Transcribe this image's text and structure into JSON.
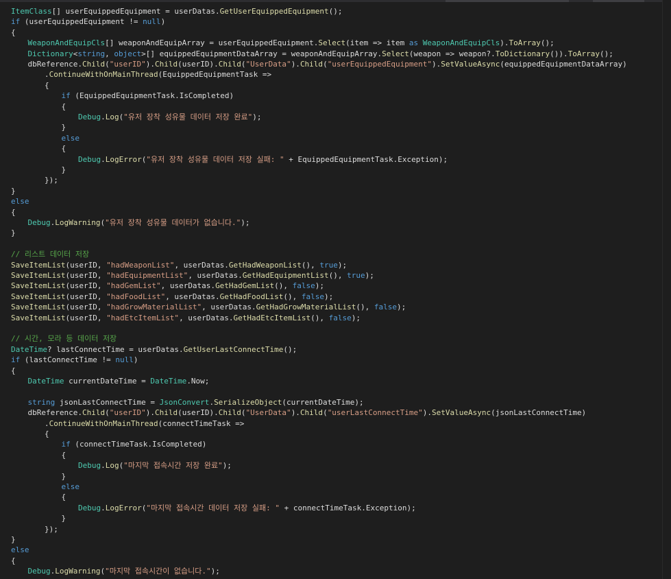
{
  "theme": {
    "background": "#1e1e1e",
    "type_color": "#4ec9b0",
    "keyword_color": "#569cd6",
    "string_color": "#d69d85",
    "comment_color": "#57a64a",
    "method_color": "#dcdcaa",
    "plain_color": "#dcdcdc"
  },
  "code": [
    {
      "indent": 0,
      "tokens": [
        [
          "ItemClass",
          "type"
        ],
        [
          "[] userEquippedEquipment = userDatas.",
          "p"
        ],
        [
          "GetUserEquippedEquipment",
          "m"
        ],
        [
          "();",
          "p"
        ]
      ]
    },
    {
      "indent": 0,
      "tokens": [
        [
          "if",
          "kw"
        ],
        [
          " (userEquippedEquipment != ",
          "p"
        ],
        [
          "null",
          "kw"
        ],
        [
          ")",
          "p"
        ]
      ]
    },
    {
      "indent": 0,
      "tokens": [
        [
          "{",
          "p"
        ]
      ]
    },
    {
      "indent": 1,
      "tokens": [
        [
          "WeaponAndEquipCls",
          "type"
        ],
        [
          "[] weaponAndEquipArray = userEquippedEquipment.",
          "p"
        ],
        [
          "Select",
          "m"
        ],
        [
          "(item => item ",
          "p"
        ],
        [
          "as",
          "kw"
        ],
        [
          " ",
          "p"
        ],
        [
          "WeaponAndEquipCls",
          "type"
        ],
        [
          ").",
          "p"
        ],
        [
          "ToArray",
          "m"
        ],
        [
          "();",
          "p"
        ]
      ]
    },
    {
      "indent": 1,
      "tokens": [
        [
          "Dictionary",
          "type"
        ],
        [
          "<",
          "p"
        ],
        [
          "string",
          "kw"
        ],
        [
          ", ",
          "p"
        ],
        [
          "object",
          "kw"
        ],
        [
          ">[] equippedEquipmentDataArray = weaponAndEquipArray.",
          "p"
        ],
        [
          "Select",
          "m"
        ],
        [
          "(weapon => weapon?.",
          "p"
        ],
        [
          "ToDictionary",
          "m"
        ],
        [
          "()).",
          "p"
        ],
        [
          "ToArray",
          "m"
        ],
        [
          "();",
          "p"
        ]
      ]
    },
    {
      "indent": 1,
      "tokens": [
        [
          "dbReference.",
          "p"
        ],
        [
          "Child",
          "m"
        ],
        [
          "(",
          "p"
        ],
        [
          "\"userID\"",
          "str"
        ],
        [
          ").",
          "p"
        ],
        [
          "Child",
          "m"
        ],
        [
          "(userID).",
          "p"
        ],
        [
          "Child",
          "m"
        ],
        [
          "(",
          "p"
        ],
        [
          "\"UserData\"",
          "str"
        ],
        [
          ").",
          "p"
        ],
        [
          "Child",
          "m"
        ],
        [
          "(",
          "p"
        ],
        [
          "\"userEquippedEquipment\"",
          "str"
        ],
        [
          ").",
          "p"
        ],
        [
          "SetValueAsync",
          "m"
        ],
        [
          "(equippedEquipmentDataArray)",
          "p"
        ]
      ]
    },
    {
      "indent": 2,
      "tokens": [
        [
          ".",
          "p"
        ],
        [
          "ContinueWithOnMainThread",
          "m"
        ],
        [
          "(EquippedEquipmentTask =>",
          "p"
        ]
      ]
    },
    {
      "indent": 2,
      "tokens": [
        [
          "{",
          "p"
        ]
      ]
    },
    {
      "indent": 3,
      "tokens": [
        [
          "if",
          "kw"
        ],
        [
          " (EquippedEquipmentTask.IsCompleted)",
          "p"
        ]
      ]
    },
    {
      "indent": 3,
      "tokens": [
        [
          "{",
          "p"
        ]
      ]
    },
    {
      "indent": 4,
      "tokens": [
        [
          "Debug",
          "type"
        ],
        [
          ".",
          "p"
        ],
        [
          "Log",
          "m"
        ],
        [
          "(",
          "p"
        ],
        [
          "\"유저 장착 성유물 데이터 저장 완료\"",
          "str"
        ],
        [
          ");",
          "p"
        ]
      ]
    },
    {
      "indent": 3,
      "tokens": [
        [
          "}",
          "p"
        ]
      ]
    },
    {
      "indent": 3,
      "tokens": [
        [
          "else",
          "kw"
        ]
      ]
    },
    {
      "indent": 3,
      "tokens": [
        [
          "{",
          "p"
        ]
      ]
    },
    {
      "indent": 4,
      "tokens": [
        [
          "Debug",
          "type"
        ],
        [
          ".",
          "p"
        ],
        [
          "LogError",
          "m"
        ],
        [
          "(",
          "p"
        ],
        [
          "\"유저 장착 성유물 데이터 저장 실패: \"",
          "str"
        ],
        [
          " + EquippedEquipmentTask.Exception);",
          "p"
        ]
      ]
    },
    {
      "indent": 3,
      "tokens": [
        [
          "}",
          "p"
        ]
      ]
    },
    {
      "indent": 2,
      "tokens": [
        [
          "});",
          "p"
        ]
      ]
    },
    {
      "indent": 0,
      "tokens": [
        [
          "}",
          "p"
        ]
      ]
    },
    {
      "indent": 0,
      "tokens": [
        [
          "else",
          "kw"
        ]
      ]
    },
    {
      "indent": 0,
      "tokens": [
        [
          "{",
          "p"
        ]
      ]
    },
    {
      "indent": 1,
      "tokens": [
        [
          "Debug",
          "type"
        ],
        [
          ".",
          "p"
        ],
        [
          "LogWarning",
          "m"
        ],
        [
          "(",
          "p"
        ],
        [
          "\"유저 장착 성유물 데이터가 없습니다.\"",
          "str"
        ],
        [
          ");",
          "p"
        ]
      ]
    },
    {
      "indent": 0,
      "tokens": [
        [
          "}",
          "p"
        ]
      ]
    },
    {
      "indent": 0,
      "tokens": []
    },
    {
      "indent": 0,
      "tokens": [
        [
          "// 리스트 데이터 저장",
          "cmt"
        ]
      ]
    },
    {
      "indent": 0,
      "tokens": [
        [
          "SaveItemList",
          "m"
        ],
        [
          "(userID, ",
          "p"
        ],
        [
          "\"hadWeaponList\"",
          "str"
        ],
        [
          ", userDatas.",
          "p"
        ],
        [
          "GetHadWeaponList",
          "m"
        ],
        [
          "(), ",
          "p"
        ],
        [
          "true",
          "kw"
        ],
        [
          ");",
          "p"
        ]
      ]
    },
    {
      "indent": 0,
      "tokens": [
        [
          "SaveItemList",
          "m"
        ],
        [
          "(userID, ",
          "p"
        ],
        [
          "\"hadEquipmentList\"",
          "str"
        ],
        [
          ", userDatas.",
          "p"
        ],
        [
          "GetHadEquipmentList",
          "m"
        ],
        [
          "(), ",
          "p"
        ],
        [
          "true",
          "kw"
        ],
        [
          ");",
          "p"
        ]
      ]
    },
    {
      "indent": 0,
      "tokens": [
        [
          "SaveItemList",
          "m"
        ],
        [
          "(userID, ",
          "p"
        ],
        [
          "\"hadGemList\"",
          "str"
        ],
        [
          ", userDatas.",
          "p"
        ],
        [
          "GetHadGemList",
          "m"
        ],
        [
          "(), ",
          "p"
        ],
        [
          "false",
          "kw"
        ],
        [
          ");",
          "p"
        ]
      ]
    },
    {
      "indent": 0,
      "tokens": [
        [
          "SaveItemList",
          "m"
        ],
        [
          "(userID, ",
          "p"
        ],
        [
          "\"hadFoodList\"",
          "str"
        ],
        [
          ", userDatas.",
          "p"
        ],
        [
          "GetHadFoodList",
          "m"
        ],
        [
          "(), ",
          "p"
        ],
        [
          "false",
          "kw"
        ],
        [
          ");",
          "p"
        ]
      ]
    },
    {
      "indent": 0,
      "tokens": [
        [
          "SaveItemList",
          "m"
        ],
        [
          "(userID, ",
          "p"
        ],
        [
          "\"hadGrowMaterialList\"",
          "str"
        ],
        [
          ", userDatas.",
          "p"
        ],
        [
          "GetHadGrowMaterialList",
          "m"
        ],
        [
          "(), ",
          "p"
        ],
        [
          "false",
          "kw"
        ],
        [
          ");",
          "p"
        ]
      ]
    },
    {
      "indent": 0,
      "tokens": [
        [
          "SaveItemList",
          "m"
        ],
        [
          "(userID, ",
          "p"
        ],
        [
          "\"hadEtcItemList\"",
          "str"
        ],
        [
          ", userDatas.",
          "p"
        ],
        [
          "GetHadEtcItemList",
          "m"
        ],
        [
          "(), ",
          "p"
        ],
        [
          "false",
          "kw"
        ],
        [
          ");",
          "p"
        ]
      ]
    },
    {
      "indent": 0,
      "tokens": []
    },
    {
      "indent": 0,
      "tokens": [
        [
          "// 시간, 모라 등 데이터 저장",
          "cmt"
        ]
      ]
    },
    {
      "indent": 0,
      "tokens": [
        [
          "DateTime",
          "type"
        ],
        [
          "? lastConnectTime = userDatas.",
          "p"
        ],
        [
          "GetUserLastConnectTime",
          "m"
        ],
        [
          "();",
          "p"
        ]
      ]
    },
    {
      "indent": 0,
      "tokens": [
        [
          "if",
          "kw"
        ],
        [
          " (lastConnectTime != ",
          "p"
        ],
        [
          "null",
          "kw"
        ],
        [
          ")",
          "p"
        ]
      ]
    },
    {
      "indent": 0,
      "tokens": [
        [
          "{",
          "p"
        ]
      ]
    },
    {
      "indent": 1,
      "tokens": [
        [
          "DateTime",
          "type"
        ],
        [
          " currentDateTime = ",
          "p"
        ],
        [
          "DateTime",
          "type"
        ],
        [
          ".Now;",
          "p"
        ]
      ]
    },
    {
      "indent": 0,
      "tokens": []
    },
    {
      "indent": 1,
      "tokens": [
        [
          "string",
          "kw"
        ],
        [
          " jsonLastConnectTime = ",
          "p"
        ],
        [
          "JsonConvert",
          "type"
        ],
        [
          ".",
          "p"
        ],
        [
          "SerializeObject",
          "m"
        ],
        [
          "(currentDateTime);",
          "p"
        ]
      ]
    },
    {
      "indent": 1,
      "tokens": [
        [
          "dbReference.",
          "p"
        ],
        [
          "Child",
          "m"
        ],
        [
          "(",
          "p"
        ],
        [
          "\"userID\"",
          "str"
        ],
        [
          ").",
          "p"
        ],
        [
          "Child",
          "m"
        ],
        [
          "(userID).",
          "p"
        ],
        [
          "Child",
          "m"
        ],
        [
          "(",
          "p"
        ],
        [
          "\"UserData\"",
          "str"
        ],
        [
          ").",
          "p"
        ],
        [
          "Child",
          "m"
        ],
        [
          "(",
          "p"
        ],
        [
          "\"userLastConnectTime\"",
          "str"
        ],
        [
          ").",
          "p"
        ],
        [
          "SetValueAsync",
          "m"
        ],
        [
          "(jsonLastConnectTime)",
          "p"
        ]
      ]
    },
    {
      "indent": 2,
      "tokens": [
        [
          ".",
          "p"
        ],
        [
          "ContinueWithOnMainThread",
          "m"
        ],
        [
          "(connectTimeTask =>",
          "p"
        ]
      ]
    },
    {
      "indent": 2,
      "tokens": [
        [
          "{",
          "p"
        ]
      ]
    },
    {
      "indent": 3,
      "tokens": [
        [
          "if",
          "kw"
        ],
        [
          " (connectTimeTask.IsCompleted)",
          "p"
        ]
      ]
    },
    {
      "indent": 3,
      "tokens": [
        [
          "{",
          "p"
        ]
      ]
    },
    {
      "indent": 4,
      "tokens": [
        [
          "Debug",
          "type"
        ],
        [
          ".",
          "p"
        ],
        [
          "Log",
          "m"
        ],
        [
          "(",
          "p"
        ],
        [
          "\"마지막 접속시간 저장 완료\"",
          "str"
        ],
        [
          ");",
          "p"
        ]
      ]
    },
    {
      "indent": 3,
      "tokens": [
        [
          "}",
          "p"
        ]
      ]
    },
    {
      "indent": 3,
      "tokens": [
        [
          "else",
          "kw"
        ]
      ]
    },
    {
      "indent": 3,
      "tokens": [
        [
          "{",
          "p"
        ]
      ]
    },
    {
      "indent": 4,
      "tokens": [
        [
          "Debug",
          "type"
        ],
        [
          ".",
          "p"
        ],
        [
          "LogError",
          "m"
        ],
        [
          "(",
          "p"
        ],
        [
          "\"마지막 접속시간 데이터 저장 실패: \"",
          "str"
        ],
        [
          " + connectTimeTask.Exception);",
          "p"
        ]
      ]
    },
    {
      "indent": 3,
      "tokens": [
        [
          "}",
          "p"
        ]
      ]
    },
    {
      "indent": 2,
      "tokens": [
        [
          "});",
          "p"
        ]
      ]
    },
    {
      "indent": 0,
      "tokens": [
        [
          "}",
          "p"
        ]
      ]
    },
    {
      "indent": 0,
      "tokens": [
        [
          "else",
          "kw"
        ]
      ]
    },
    {
      "indent": 0,
      "tokens": [
        [
          "{",
          "p"
        ]
      ]
    },
    {
      "indent": 1,
      "tokens": [
        [
          "Debug",
          "type"
        ],
        [
          ".",
          "p"
        ],
        [
          "LogWarning",
          "m"
        ],
        [
          "(",
          "p"
        ],
        [
          "\"마지막 접속시간이 없습니다.\"",
          "str"
        ],
        [
          ");",
          "p"
        ]
      ]
    }
  ]
}
